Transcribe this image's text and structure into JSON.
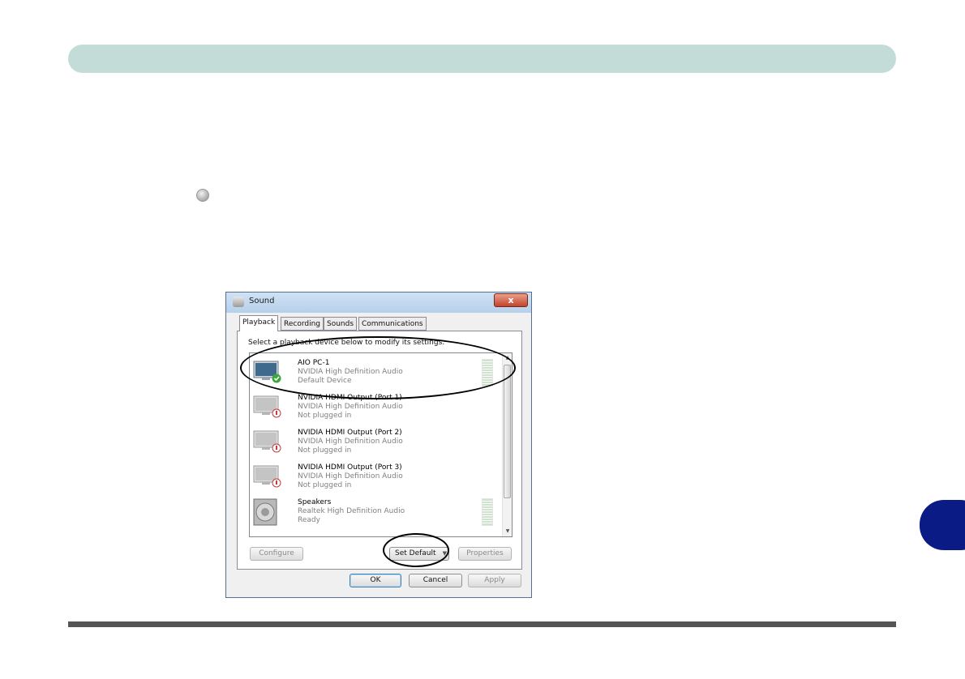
{
  "dialog": {
    "title": "Sound",
    "close_label": "x",
    "tabs": [
      "Playback",
      "Recording",
      "Sounds",
      "Communications"
    ],
    "instruction": "Select a playback device below to modify its settings:",
    "devices": [
      {
        "name": "AIO PC-1",
        "driver": "NVIDIA High Definition Audio",
        "status": "Default Device",
        "icon": "monitor-icon",
        "badge": "check-badge-icon"
      },
      {
        "name": "NVIDIA HDMI Output (Port 1)",
        "driver": "NVIDIA High Definition Audio",
        "status": "Not plugged in",
        "icon": "monitor-icon",
        "badge": "unplugged-badge-icon"
      },
      {
        "name": "NVIDIA HDMI Output (Port 2)",
        "driver": "NVIDIA High Definition Audio",
        "status": "Not plugged in",
        "icon": "monitor-icon",
        "badge": "unplugged-badge-icon"
      },
      {
        "name": "NVIDIA HDMI Output (Port 3)",
        "driver": "NVIDIA High Definition Audio",
        "status": "Not plugged in",
        "icon": "monitor-icon",
        "badge": "unplugged-badge-icon"
      },
      {
        "name": "Speakers",
        "driver": "Realtek High Definition Audio",
        "status": "Ready",
        "icon": "speaker-icon",
        "badge": ""
      }
    ],
    "buttons": {
      "configure": "Configure",
      "set_default": "Set Default",
      "set_default_arrow": "▼",
      "properties": "Properties",
      "ok": "OK",
      "cancel": "Cancel",
      "apply": "Apply"
    }
  },
  "colors": {
    "header_bar": "#c3dcd7",
    "chapter_tab": "#0b1b85",
    "footer_line": "#555555"
  }
}
